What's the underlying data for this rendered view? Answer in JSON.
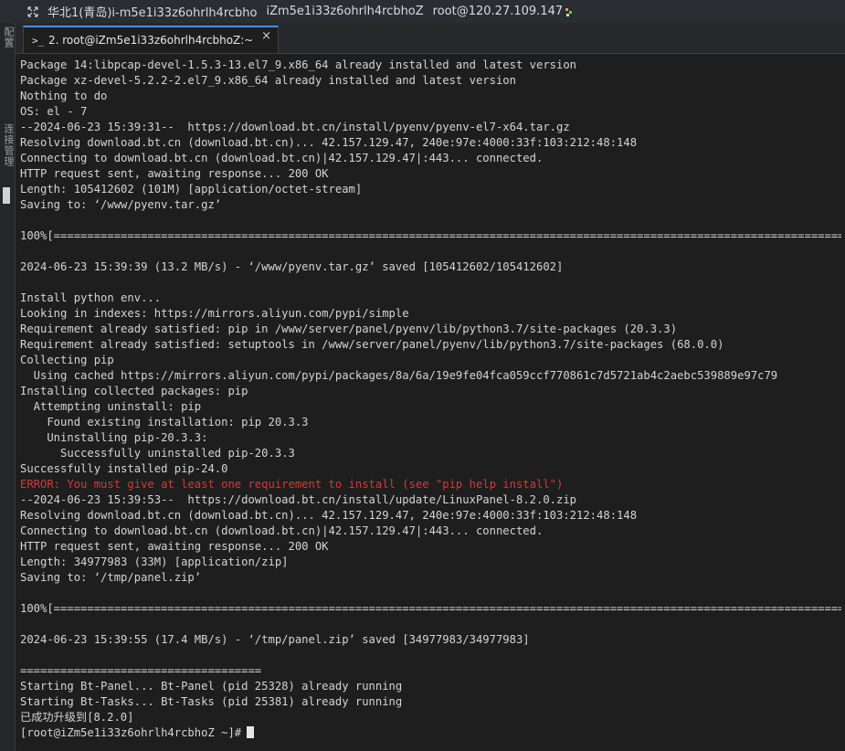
{
  "window": {
    "title_parts": [
      "华北1(青岛)i-m5e1i33z6ohrlh4rcbho",
      "iZm5e1i33z6ohrlh4rcbhoZ",
      "root@120.27.109.147"
    ]
  },
  "sidebar": {
    "vertical_text_top": "配置",
    "vertical_text_bottom": "连接管理"
  },
  "tabs": [
    {
      "label": "2. root@iZm5e1i33z6ohrlh4rcbhoZ:~",
      "icon": "terminal-prompt-icon",
      "close": "×",
      "active": true
    }
  ],
  "terminal": {
    "lines": [
      {
        "text": "Package 14:libpcap-devel-1.5.3-13.el7_9.x86_64 already installed and latest version",
        "kind": "normal"
      },
      {
        "text": "Package xz-devel-5.2.2-2.el7_9.x86_64 already installed and latest version",
        "kind": "normal"
      },
      {
        "text": "Nothing to do",
        "kind": "normal"
      },
      {
        "text": "OS: el - 7",
        "kind": "normal"
      },
      {
        "text": "--2024-06-23 15:39:31--  https://download.bt.cn/install/pyenv/pyenv-el7-x64.tar.gz",
        "kind": "normal"
      },
      {
        "text": "Resolving download.bt.cn (download.bt.cn)... 42.157.129.47, 240e:97e:4000:33f:103:212:48:148",
        "kind": "normal"
      },
      {
        "text": "Connecting to download.bt.cn (download.bt.cn)|42.157.129.47|:443... connected.",
        "kind": "normal"
      },
      {
        "text": "HTTP request sent, awaiting response... 200 OK",
        "kind": "normal"
      },
      {
        "text": "Length: 105412602 (101M) [application/octet-stream]",
        "kind": "normal"
      },
      {
        "text": "Saving to: ‘/www/pyenv.tar.gz’",
        "kind": "normal"
      },
      {
        "text": "",
        "kind": "normal"
      },
      {
        "text": "100%[============================================================================================================================================",
        "kind": "normal"
      },
      {
        "text": "",
        "kind": "normal"
      },
      {
        "text": "2024-06-23 15:39:39 (13.2 MB/s) - ‘/www/pyenv.tar.gz’ saved [105412602/105412602]",
        "kind": "normal"
      },
      {
        "text": "",
        "kind": "normal"
      },
      {
        "text": "Install python env...",
        "kind": "normal"
      },
      {
        "text": "Looking in indexes: https://mirrors.aliyun.com/pypi/simple",
        "kind": "normal"
      },
      {
        "text": "Requirement already satisfied: pip in /www/server/panel/pyenv/lib/python3.7/site-packages (20.3.3)",
        "kind": "normal"
      },
      {
        "text": "Requirement already satisfied: setuptools in /www/server/panel/pyenv/lib/python3.7/site-packages (68.0.0)",
        "kind": "normal"
      },
      {
        "text": "Collecting pip",
        "kind": "normal"
      },
      {
        "text": "  Using cached https://mirrors.aliyun.com/pypi/packages/8a/6a/19e9fe04fca059ccf770861c7d5721ab4c2aebc539889e97c79",
        "kind": "normal"
      },
      {
        "text": "Installing collected packages: pip",
        "kind": "normal"
      },
      {
        "text": "  Attempting uninstall: pip",
        "kind": "normal"
      },
      {
        "text": "    Found existing installation: pip 20.3.3",
        "kind": "normal"
      },
      {
        "text": "    Uninstalling pip-20.3.3:",
        "kind": "normal"
      },
      {
        "text": "      Successfully uninstalled pip-20.3.3",
        "kind": "normal"
      },
      {
        "text": "Successfully installed pip-24.0",
        "kind": "normal"
      },
      {
        "text": "ERROR: You must give at least one requirement to install (see \"pip help install\")",
        "kind": "error"
      },
      {
        "text": "--2024-06-23 15:39:53--  https://download.bt.cn/install/update/LinuxPanel-8.2.0.zip",
        "kind": "normal"
      },
      {
        "text": "Resolving download.bt.cn (download.bt.cn)... 42.157.129.47, 240e:97e:4000:33f:103:212:48:148",
        "kind": "normal"
      },
      {
        "text": "Connecting to download.bt.cn (download.bt.cn)|42.157.129.47|:443... connected.",
        "kind": "normal"
      },
      {
        "text": "HTTP request sent, awaiting response... 200 OK",
        "kind": "normal"
      },
      {
        "text": "Length: 34977983 (33M) [application/zip]",
        "kind": "normal"
      },
      {
        "text": "Saving to: ‘/tmp/panel.zip’",
        "kind": "normal"
      },
      {
        "text": "",
        "kind": "normal"
      },
      {
        "text": "100%[============================================================================================================================================",
        "kind": "normal"
      },
      {
        "text": "",
        "kind": "normal"
      },
      {
        "text": "2024-06-23 15:39:55 (17.4 MB/s) - ‘/tmp/panel.zip’ saved [34977983/34977983]",
        "kind": "normal"
      },
      {
        "text": "",
        "kind": "normal"
      },
      {
        "text": "====================================",
        "kind": "normal"
      },
      {
        "text": "Starting Bt-Panel... Bt-Panel (pid 25328) already running",
        "kind": "normal"
      },
      {
        "text": "Starting Bt-Tasks... Bt-Tasks (pid 25381) already running",
        "kind": "normal"
      },
      {
        "text": "已成功升级到[8.2.0]",
        "kind": "normal"
      },
      {
        "text": "[root@iZm5e1i33z6ohrlh4rcbhoZ ~]#",
        "kind": "prompt"
      }
    ],
    "colors": {
      "background": "#1e1e1e",
      "foreground": "#d4d4d4",
      "error": "#d23a3a",
      "tab_accent": "#3794ff"
    }
  }
}
